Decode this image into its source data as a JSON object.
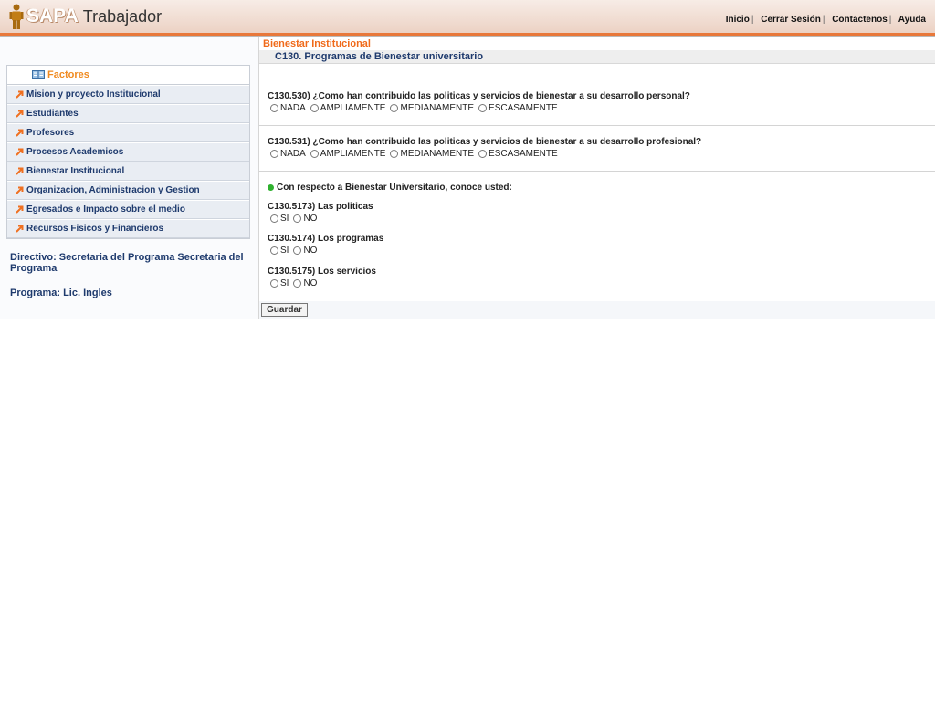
{
  "header": {
    "logo_sapa": "SAPA",
    "logo_app": "Trabajador",
    "nav": [
      "Inicio",
      "Cerrar Sesión",
      "Contactenos",
      "Ayuda"
    ],
    "separator": "|"
  },
  "sidebar": {
    "title": "Factores",
    "items": [
      "Mision y proyecto Institucional",
      "Estudiantes",
      "Profesores",
      "Procesos Academicos",
      "Bienestar Institucional",
      "Organizacion, Administracion y Gestion",
      "Egresados e Impacto sobre el medio",
      "Recursos Fisicos y Financieros"
    ],
    "directivo": "Directivo: Secretaria del Programa Secretaria del Programa",
    "programa": "Programa: Lic. Ingles"
  },
  "main": {
    "section": "Bienestar Institucional",
    "subtitle": "C130. Programas de Bienestar universitario",
    "questions": [
      {
        "text": "C130.530) ¿Como han contribuido las politicas y servicios de bienestar a su desarrollo personal?",
        "options": [
          "NADA",
          "AMPLIAMENTE",
          "MEDIANAMENTE",
          "ESCASAMENTE"
        ]
      },
      {
        "text": "C130.531) ¿Como han contribuido las politicas y servicios de bienestar a su desarrollo profesional?",
        "options": [
          "NADA",
          "AMPLIAMENTE",
          "MEDIANAMENTE",
          "ESCASAMENTE"
        ]
      }
    ],
    "intro": "Con respecto a Bienestar Universitario, conoce usted:",
    "yesno": [
      {
        "text": "C130.5173) Las politicas",
        "options": [
          "SI",
          "NO"
        ]
      },
      {
        "text": "C130.5174) Los programas",
        "options": [
          "SI",
          "NO"
        ]
      },
      {
        "text": "C130.5175) Los servicios",
        "options": [
          "SI",
          "NO"
        ]
      }
    ],
    "save_label": "Guardar"
  },
  "colors": {
    "header_accent": "#e8783a",
    "section_title": "#f06a1a",
    "link_blue": "#1e3a6d",
    "factores_orange": "#f08a1f"
  }
}
